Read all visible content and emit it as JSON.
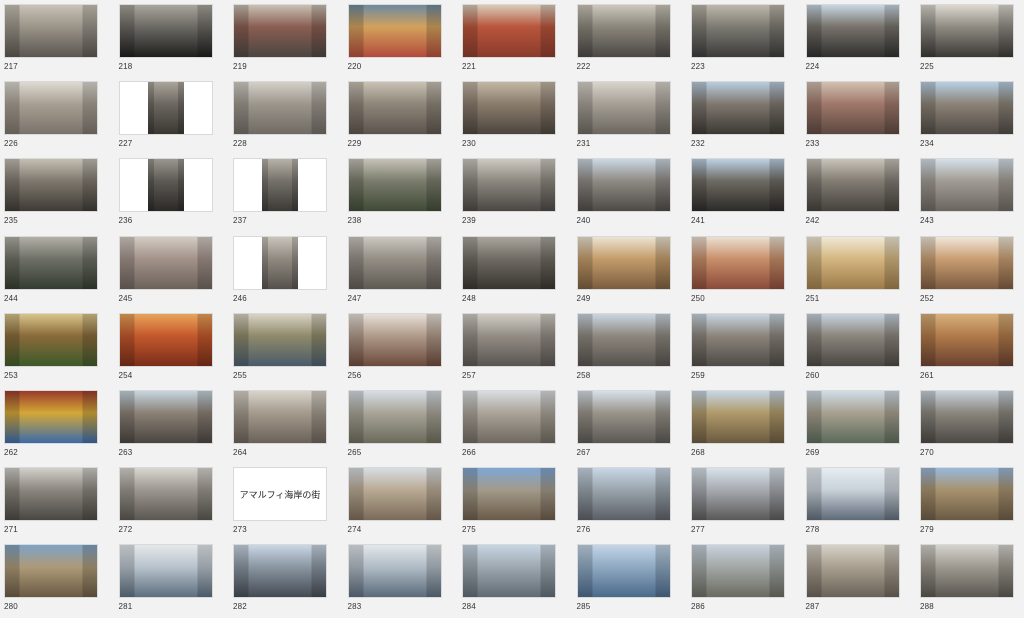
{
  "items": [
    {
      "number": "217",
      "kind": "photo",
      "colors": [
        "#5a5650",
        "#9a9489",
        "#c9c2b6"
      ]
    },
    {
      "number": "218",
      "kind": "photo",
      "colors": [
        "#1e1e1e",
        "#6b6963",
        "#a8a59c"
      ]
    },
    {
      "number": "219",
      "kind": "photo",
      "colors": [
        "#4b4540",
        "#8a5e52",
        "#c7c0b3"
      ]
    },
    {
      "number": "220",
      "kind": "photo",
      "colors": [
        "#b24b3a",
        "#d3a15c",
        "#6c8aa1"
      ]
    },
    {
      "number": "221",
      "kind": "photo",
      "colors": [
        "#8a3b2c",
        "#b8553c",
        "#d9cbb8"
      ]
    },
    {
      "number": "222",
      "kind": "photo",
      "colors": [
        "#4a4744",
        "#8b867c",
        "#cdc7bb"
      ]
    },
    {
      "number": "223",
      "kind": "photo",
      "colors": [
        "#3b3b3b",
        "#7d7a72",
        "#bdb7ab"
      ]
    },
    {
      "number": "224",
      "kind": "photo",
      "colors": [
        "#2f2f2f",
        "#77726a",
        "#c7d7e2"
      ]
    },
    {
      "number": "225",
      "kind": "photo",
      "colors": [
        "#3a3835",
        "#8f8b83",
        "#dcd8cf"
      ]
    },
    {
      "number": "226",
      "kind": "photo",
      "colors": [
        "#7a736a",
        "#a79f93",
        "#dedad2"
      ]
    },
    {
      "number": "227",
      "kind": "portrait",
      "colors": [
        "#3a3733",
        "#6c6760",
        "#aaa49a"
      ]
    },
    {
      "number": "228",
      "kind": "photo",
      "colors": [
        "#6f6a63",
        "#9c968c",
        "#d4d0c8"
      ]
    },
    {
      "number": "229",
      "kind": "photo",
      "colors": [
        "#5b544c",
        "#8f867a",
        "#c9c1b4"
      ]
    },
    {
      "number": "230",
      "kind": "photo",
      "colors": [
        "#4c453e",
        "#8a7c6c",
        "#c2b6a5"
      ]
    },
    {
      "number": "231",
      "kind": "photo",
      "colors": [
        "#6b665f",
        "#a59f95",
        "#d8d4cc"
      ]
    },
    {
      "number": "232",
      "kind": "photo",
      "colors": [
        "#3c3833",
        "#7f7870",
        "#b9cde0"
      ]
    },
    {
      "number": "233",
      "kind": "photo",
      "colors": [
        "#5c4840",
        "#a0786a",
        "#d1c0b0"
      ]
    },
    {
      "number": "234",
      "kind": "photo",
      "colors": [
        "#4e4944",
        "#8b8376",
        "#b8cfe6"
      ]
    },
    {
      "number": "235",
      "kind": "photo",
      "colors": [
        "#3e3a35",
        "#7f786e",
        "#c4beb3"
      ]
    },
    {
      "number": "236",
      "kind": "portrait",
      "colors": [
        "#2b2926",
        "#5d5a55",
        "#9a968f"
      ]
    },
    {
      "number": "237",
      "kind": "portrait",
      "colors": [
        "#3b3935",
        "#75716a",
        "#b7b2a8"
      ]
    },
    {
      "number": "238",
      "kind": "photo",
      "colors": [
        "#3f4a35",
        "#7a7c6c",
        "#c6c2b8"
      ]
    },
    {
      "number": "239",
      "kind": "photo",
      "colors": [
        "#4a4743",
        "#8c877f",
        "#cdc9c1"
      ]
    },
    {
      "number": "240",
      "kind": "photo",
      "colors": [
        "#4d4a46",
        "#8e8a83",
        "#cbd8e3"
      ]
    },
    {
      "number": "241",
      "kind": "photo",
      "colors": [
        "#2c2a28",
        "#6e6a63",
        "#bcd1e5"
      ]
    },
    {
      "number": "242",
      "kind": "photo",
      "colors": [
        "#45413c",
        "#827c73",
        "#c9c4ba"
      ]
    },
    {
      "number": "243",
      "kind": "photo",
      "colors": [
        "#6a655e",
        "#a19c93",
        "#d5e0ea"
      ]
    },
    {
      "number": "244",
      "kind": "photo",
      "colors": [
        "#343b30",
        "#6e7066",
        "#b3b0a6"
      ]
    },
    {
      "number": "245",
      "kind": "photo",
      "colors": [
        "#6c625a",
        "#a2928a",
        "#d3cbc2"
      ]
    },
    {
      "number": "246",
      "kind": "portrait",
      "colors": [
        "#55504a",
        "#8f8980",
        "#c9c4bb"
      ]
    },
    {
      "number": "247",
      "kind": "photo",
      "colors": [
        "#5e5952",
        "#948e85",
        "#cbc7bf"
      ]
    },
    {
      "number": "248",
      "kind": "photo",
      "colors": [
        "#38352f",
        "#6f6b63",
        "#a9a59d"
      ]
    },
    {
      "number": "249",
      "kind": "photo",
      "colors": [
        "#7a5d3f",
        "#c49c6a",
        "#ece3d1"
      ]
    },
    {
      "number": "250",
      "kind": "photo",
      "colors": [
        "#8a4a3a",
        "#c98f6a",
        "#eae0d2"
      ]
    },
    {
      "number": "251",
      "kind": "photo",
      "colors": [
        "#9c7a4a",
        "#d4b680",
        "#f0e8d6"
      ]
    },
    {
      "number": "252",
      "kind": "photo",
      "colors": [
        "#7b5a40",
        "#c99e72",
        "#efe6d8"
      ]
    },
    {
      "number": "253",
      "kind": "photo",
      "colors": [
        "#3d5a2a",
        "#8a6a3a",
        "#d8c48a"
      ]
    },
    {
      "number": "254",
      "kind": "photo",
      "colors": [
        "#7a2e1a",
        "#c4582c",
        "#e8a35a"
      ]
    },
    {
      "number": "255",
      "kind": "photo",
      "colors": [
        "#4a5b6a",
        "#8f8a6a",
        "#d8d3c4"
      ]
    },
    {
      "number": "256",
      "kind": "photo",
      "colors": [
        "#6a4a3a",
        "#b09a8a",
        "#e6e0d8"
      ]
    },
    {
      "number": "257",
      "kind": "photo",
      "colors": [
        "#5a5550",
        "#928c84",
        "#d0ccc4"
      ]
    },
    {
      "number": "258",
      "kind": "photo",
      "colors": [
        "#55514c",
        "#8d877e",
        "#c9d6e2"
      ]
    },
    {
      "number": "259",
      "kind": "photo",
      "colors": [
        "#4e4a45",
        "#8a847b",
        "#c8d5e0"
      ]
    },
    {
      "number": "260",
      "kind": "photo",
      "colors": [
        "#4b4742",
        "#8b857c",
        "#c6d3de"
      ]
    },
    {
      "number": "261",
      "kind": "photo",
      "colors": [
        "#6a4030",
        "#b07a4a",
        "#d8b07a"
      ]
    },
    {
      "number": "262",
      "kind": "photo",
      "colors": [
        "#3b6aa8",
        "#d4a838",
        "#9a3a2a"
      ]
    },
    {
      "number": "263",
      "kind": "photo",
      "colors": [
        "#4a4540",
        "#8b8176",
        "#c5d5e0"
      ]
    },
    {
      "number": "264",
      "kind": "photo",
      "colors": [
        "#6a6158",
        "#a49a8d",
        "#d8d3ca"
      ]
    },
    {
      "number": "265",
      "kind": "photo",
      "colors": [
        "#6b6a5a",
        "#a8a498",
        "#d6dde4"
      ]
    },
    {
      "number": "266",
      "kind": "photo",
      "colors": [
        "#6e6860",
        "#aaa398",
        "#d9dde1"
      ]
    },
    {
      "number": "267",
      "kind": "photo",
      "colors": [
        "#5a5752",
        "#99938a",
        "#d6e0e8"
      ]
    },
    {
      "number": "268",
      "kind": "photo",
      "colors": [
        "#6a5a40",
        "#b09a6a",
        "#c6d6e6"
      ]
    },
    {
      "number": "269",
      "kind": "photo",
      "colors": [
        "#5a6a5a",
        "#a8a090",
        "#cfdde8"
      ]
    },
    {
      "number": "270",
      "kind": "photo",
      "colors": [
        "#4c4844",
        "#8a857d",
        "#c8d3dd"
      ]
    },
    {
      "number": "271",
      "kind": "photo",
      "colors": [
        "#4a4743",
        "#8b867e",
        "#d2d0cb"
      ]
    },
    {
      "number": "272",
      "kind": "photo",
      "colors": [
        "#5a5650",
        "#9c978f",
        "#d9d6d0"
      ]
    },
    {
      "number": "273",
      "kind": "text",
      "text": "アマルフィ海岸の街",
      "colors": [
        "#ffffff",
        "#ffffff",
        "#ffffff"
      ]
    },
    {
      "number": "274",
      "kind": "photo",
      "colors": [
        "#7a6a58",
        "#b9aa94",
        "#d8dde2"
      ]
    },
    {
      "number": "275",
      "kind": "photo",
      "colors": [
        "#6a5a48",
        "#a39a8a",
        "#7ea7d4"
      ]
    },
    {
      "number": "276",
      "kind": "photo",
      "colors": [
        "#5a5f66",
        "#9aa4ac",
        "#c9d8e6"
      ]
    },
    {
      "number": "277",
      "kind": "photo",
      "colors": [
        "#5a5858",
        "#a7aab0",
        "#d8e2ea"
      ]
    },
    {
      "number": "278",
      "kind": "photo",
      "colors": [
        "#5f6a78",
        "#c9d1d9",
        "#e6edf2"
      ]
    },
    {
      "number": "279",
      "kind": "photo",
      "colors": [
        "#6a5a44",
        "#a8926e",
        "#98b8dc"
      ]
    },
    {
      "number": "280",
      "kind": "photo",
      "colors": [
        "#6a5a44",
        "#ad9a78",
        "#7fa3c7"
      ]
    },
    {
      "number": "281",
      "kind": "photo",
      "colors": [
        "#5c6e7e",
        "#b8c3cc",
        "#e4e8ea"
      ]
    },
    {
      "number": "282",
      "kind": "photo",
      "colors": [
        "#444a52",
        "#8a96a2",
        "#c9d6e3"
      ]
    },
    {
      "number": "283",
      "kind": "photo",
      "colors": [
        "#5a6a7a",
        "#b1bcc6",
        "#e2e7eb"
      ]
    },
    {
      "number": "284",
      "kind": "photo",
      "colors": [
        "#5f6b74",
        "#9ea8b0",
        "#c7d6e4"
      ]
    },
    {
      "number": "285",
      "kind": "photo",
      "colors": [
        "#4a6a8a",
        "#8fa9c2",
        "#c3d5e6"
      ]
    },
    {
      "number": "286",
      "kind": "photo",
      "colors": [
        "#6a6a60",
        "#a3a8a6",
        "#c8d3dd"
      ]
    },
    {
      "number": "287",
      "kind": "photo",
      "colors": [
        "#6a6258",
        "#a99f90",
        "#d6d2c8"
      ]
    },
    {
      "number": "288",
      "kind": "photo",
      "colors": [
        "#5a5650",
        "#9e998f",
        "#d5d3ce"
      ]
    }
  ]
}
